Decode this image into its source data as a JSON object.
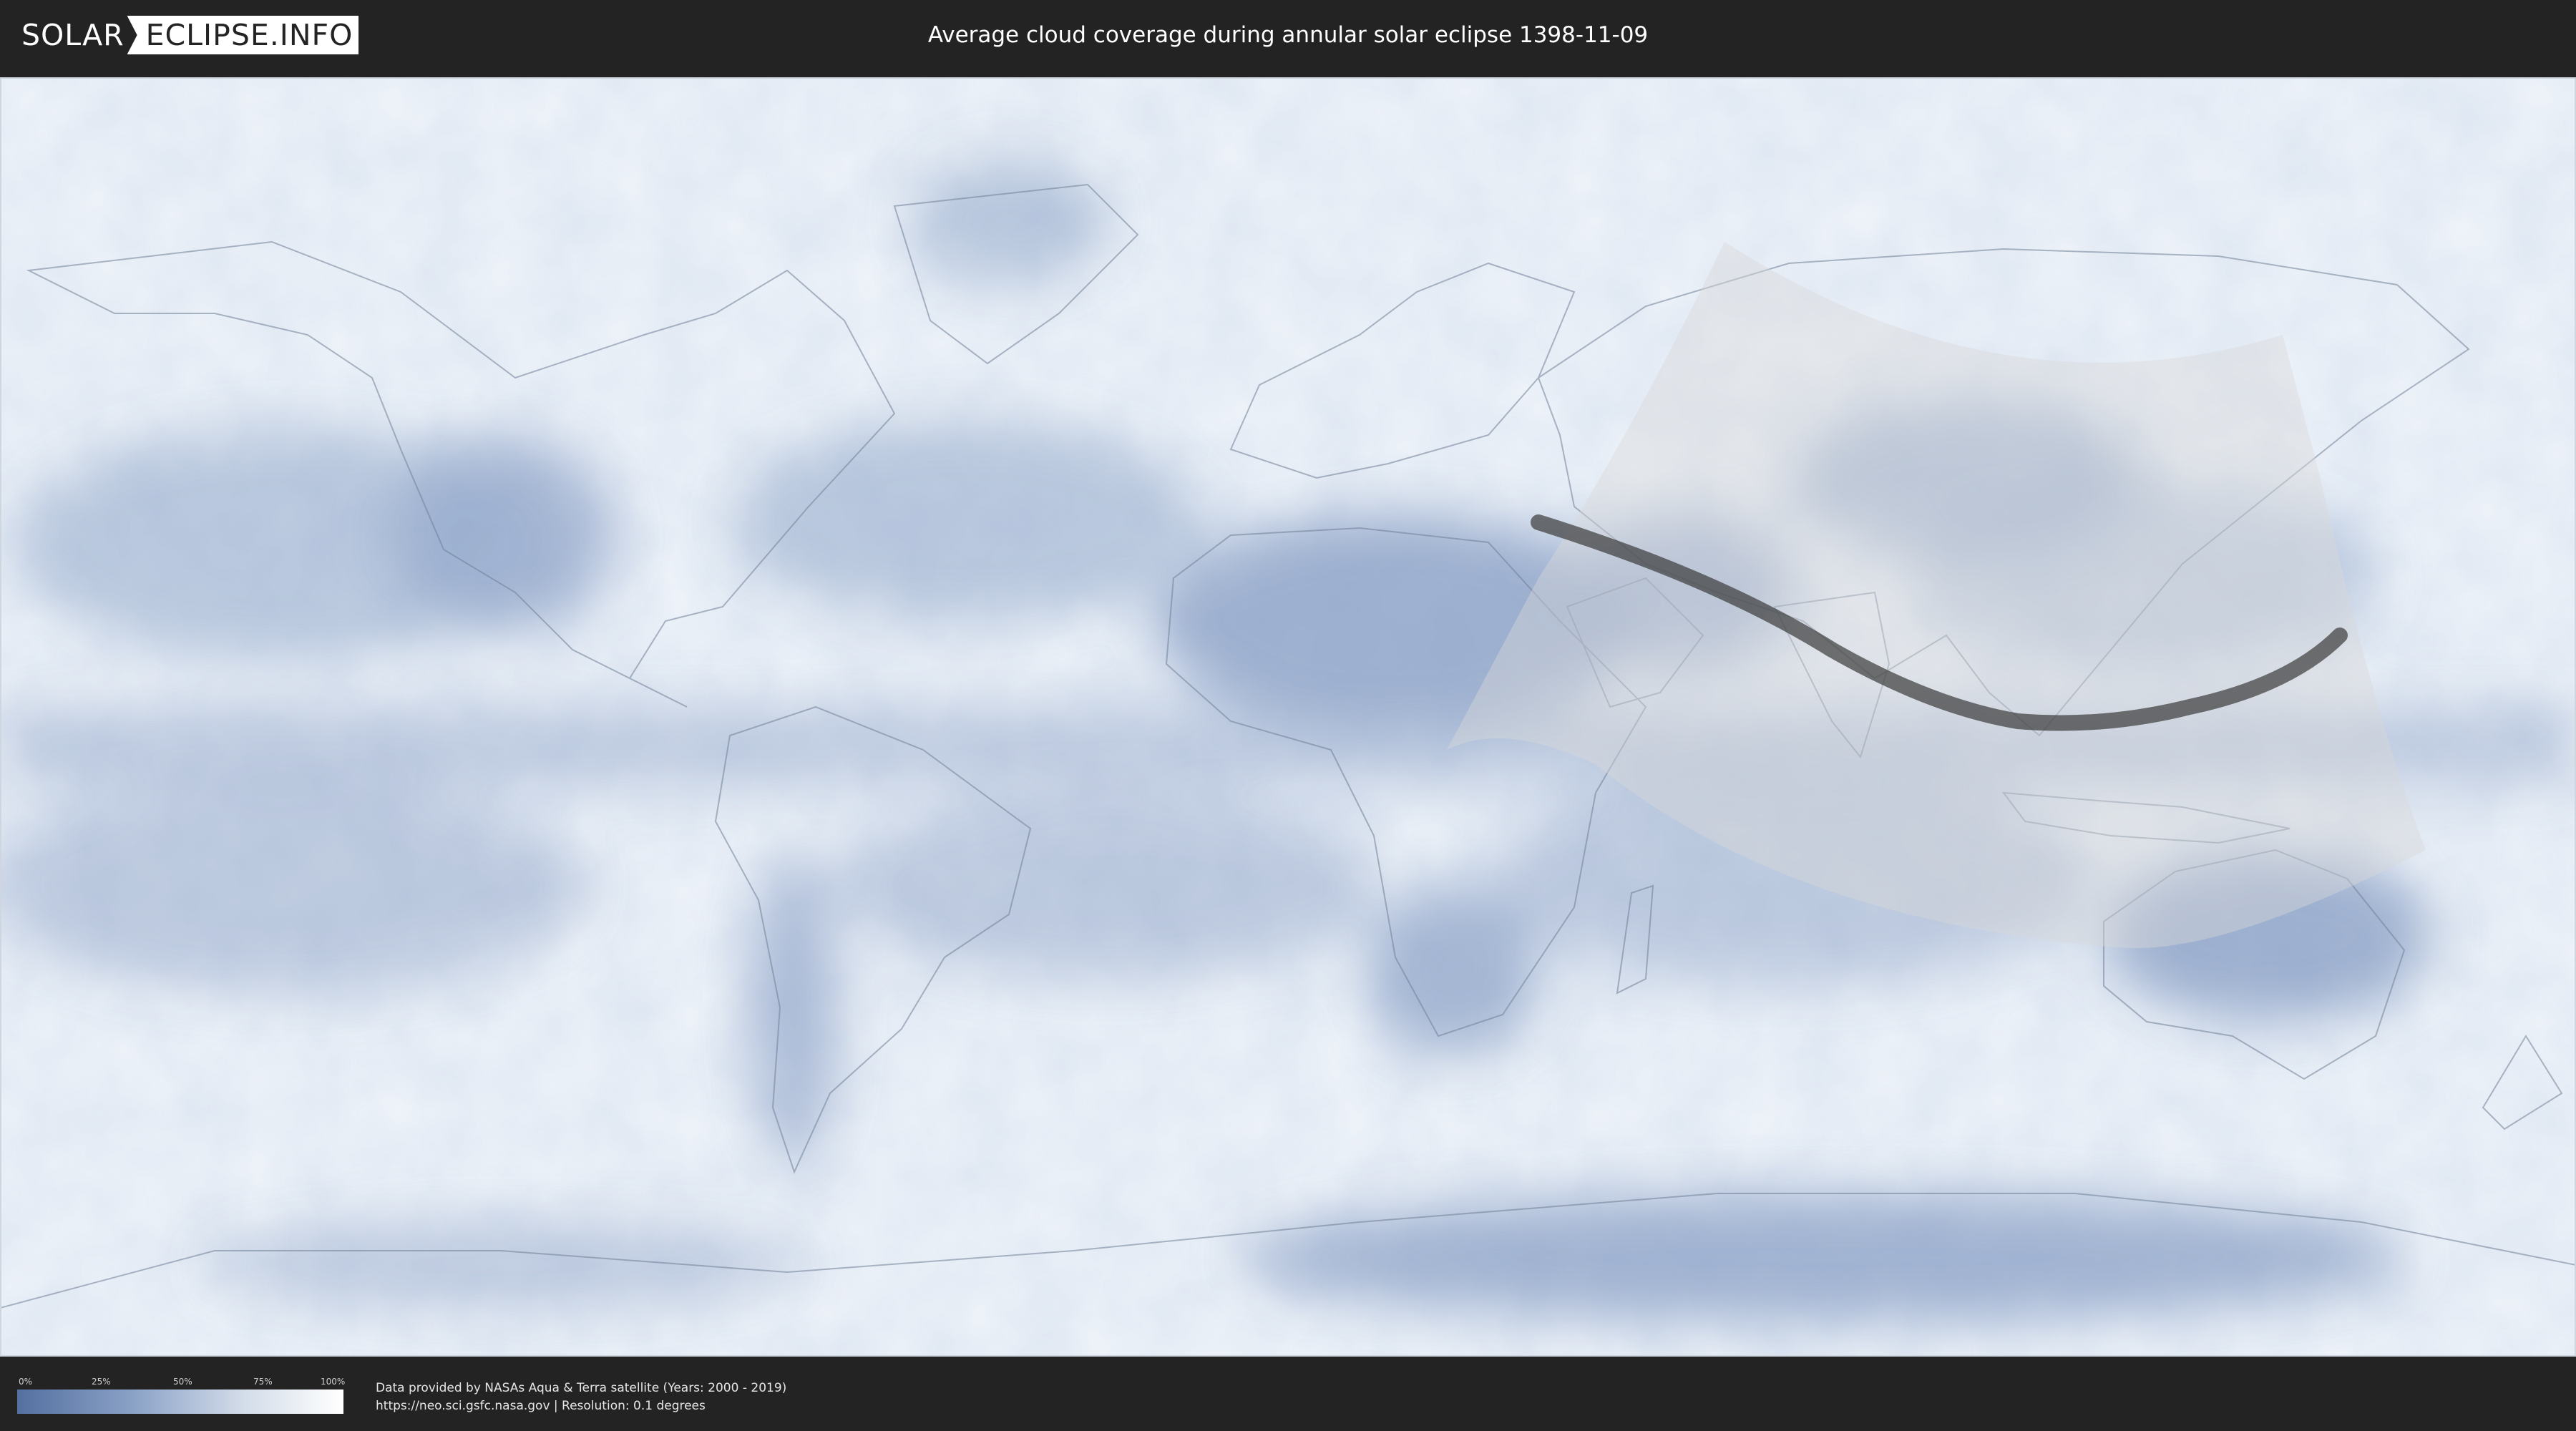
{
  "header": {
    "logo_part1": "SOLAR",
    "logo_part2": "ECLIPSE.INFO",
    "title": "Average cloud coverage during annular solar eclipse 1398-11-09"
  },
  "map": {
    "colors": {
      "ocean_clear": "#7d95bf",
      "ocean_cloudy": "#eef3f9",
      "land_outline": "#6f7f95",
      "visibility_zone": "#d9d9d9",
      "annular_path": "#3a3a3a"
    }
  },
  "legend": {
    "ticks": [
      "0%",
      "25%",
      "50%",
      "75%",
      "100%"
    ],
    "gradient": [
      "#5470a0",
      "#8aa1c6",
      "#d4ddea",
      "#ffffff"
    ]
  },
  "credits": {
    "line1": "Data provided by NASAs Aqua & Terra satellite (Years: 2000 - 2019)",
    "line2": "https://neo.sci.gsfc.nasa.gov | Resolution: 0.1 degrees"
  }
}
